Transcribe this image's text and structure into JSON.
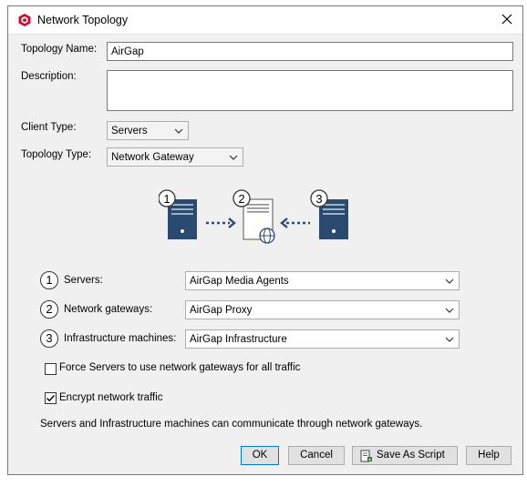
{
  "window": {
    "title": "Network Topology",
    "app_icon": "app-logo-icon",
    "close_icon": "close-icon"
  },
  "form": {
    "topology_name_label": "Topology Name:",
    "topology_name_value": "AirGap",
    "description_label": "Description:",
    "description_value": "",
    "client_type_label": "Client Type:",
    "client_type_value": "Servers",
    "topology_type_label": "Topology Type:",
    "topology_type_value": "Network Gateway"
  },
  "diagram": {
    "steps": [
      "1",
      "2",
      "3"
    ]
  },
  "groups": [
    {
      "number": "1",
      "label": "Servers:",
      "value": "AirGap Media Agents"
    },
    {
      "number": "2",
      "label": "Network gateways:",
      "value": "AirGap Proxy"
    },
    {
      "number": "3",
      "label": "Infrastructure machines:",
      "value": "AirGap Infrastructure"
    }
  ],
  "options": {
    "force_label": "Force Servers to use network gateways for all traffic",
    "force_checked": false,
    "encrypt_label": "Encrypt network traffic",
    "encrypt_checked": true
  },
  "info_text": "Servers and Infrastructure machines can communicate through network gateways.",
  "buttons": {
    "ok": "OK",
    "cancel": "Cancel",
    "save_script": "Save As Script",
    "help": "Help"
  },
  "colors": {
    "server_blue": "#2b4a6f",
    "accent_red": "#c8102e",
    "focus_blue": "#0078d7"
  }
}
